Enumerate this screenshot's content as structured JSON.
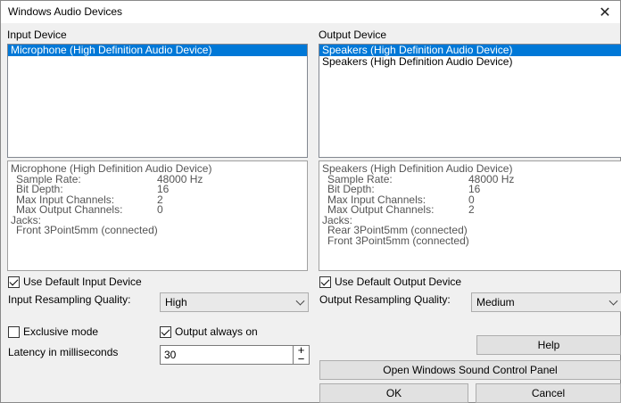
{
  "window": {
    "title": "Windows Audio Devices",
    "close_glyph": "✕"
  },
  "input": {
    "label": "Input Device",
    "devices": [
      "Microphone (High Definition Audio Device)"
    ],
    "selected_index": 0,
    "info": {
      "name": "Microphone (High Definition Audio Device)",
      "rows": [
        {
          "label": "Sample Rate:",
          "value": "48000 Hz"
        },
        {
          "label": "Bit Depth:",
          "value": "16"
        },
        {
          "label": "Max Input Channels:",
          "value": "2"
        },
        {
          "label": "Max Output Channels:",
          "value": "0"
        }
      ],
      "jacks_label": "Jacks:",
      "jacks": [
        "Front 3Point5mm (connected)"
      ]
    },
    "use_default_label": "Use Default Input Device",
    "use_default_checked": true,
    "resampling_label": "Input Resampling Quality:",
    "resampling_value": "High"
  },
  "output": {
    "label": "Output Device",
    "devices": [
      "Speakers (High Definition Audio Device)",
      "Speakers (High Definition Audio Device)"
    ],
    "selected_index": 0,
    "info": {
      "name": "Speakers (High Definition Audio Device)",
      "rows": [
        {
          "label": "Sample Rate:",
          "value": "48000 Hz"
        },
        {
          "label": "Bit Depth:",
          "value": "16"
        },
        {
          "label": "Max Input Channels:",
          "value": "0"
        },
        {
          "label": "Max Output Channels:",
          "value": "2"
        }
      ],
      "jacks_label": "Jacks:",
      "jacks": [
        "Rear 3Point5mm (connected)",
        "Front 3Point5mm (connected)"
      ]
    },
    "use_default_label": "Use Default Output Device",
    "use_default_checked": true,
    "resampling_label": "Output Resampling Quality:",
    "resampling_value": "Medium"
  },
  "options": {
    "exclusive_label": "Exclusive mode",
    "exclusive_checked": false,
    "always_on_label": "Output always on",
    "always_on_checked": true,
    "latency_label": "Latency in milliseconds",
    "latency_value": "30",
    "spin_up": "+",
    "spin_down": "−"
  },
  "buttons": {
    "help": "Help",
    "sound_panel": "Open Windows Sound Control Panel",
    "ok": "OK",
    "cancel": "Cancel"
  },
  "colors": {
    "selection": "#0078d7"
  }
}
